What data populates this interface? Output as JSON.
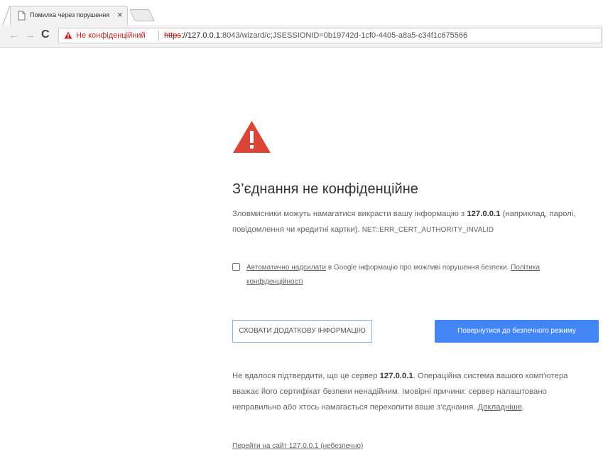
{
  "colors": {
    "accent": "#4285f4",
    "danger": "#db4437",
    "insecure_text": "#c5221f"
  },
  "tab": {
    "title": "Помилка через порушення",
    "close_glyph": "×",
    "icon": "page-icon"
  },
  "toolbar": {
    "back_glyph": "←",
    "forward_glyph": "→",
    "reload_glyph": "C",
    "security_label": "Не конфіденційний",
    "url_scheme": "https",
    "url_host": "://127.0.0.1",
    "url_rest": ":8043/wizard/c;JSESSIONID=0b19742d-1cf0-4405-a8a5-c34f1c675566"
  },
  "interstitial": {
    "icon": "warning-triangle-icon",
    "heading": "З’єднання не конфіденційне",
    "p1_before": "Зловмисники можуть намагатися викрасти вашу інформацію з ",
    "p1_host": "127.0.0.1",
    "p1_after": " (наприклад, паролі, повідомлення чи кредитні картки). ",
    "error_code": "NET::ERR_CERT_AUTHORITY_INVALID",
    "report_link": "Автоматично надсилати",
    "report_text": " в Google інформацію про можливі порушення безпеки. ",
    "privacy_link": "Політика конфіденційності",
    "hide_details_button": "СХОВАТИ ДОДАТКОВУ ІНФОРМАЦІЮ",
    "back_to_safety_button": "Повернутися до безпечного режиму",
    "p2_before": "Не вдалося підтвердити, що це сервер ",
    "p2_host": "127.0.0.1",
    "p2_after": ". Операційна система вашого комп’ютера вважає його сертифікат безпеки ненадійним. Імовірні причини: сервер налаштовано неправильно або хтось намагається перехопити ваше з’єднання. ",
    "learn_more": "Докладніше",
    "learn_more_suffix": ".",
    "proceed_link": "Перейти на сайт 127.0.0.1 (небезпечно)"
  }
}
